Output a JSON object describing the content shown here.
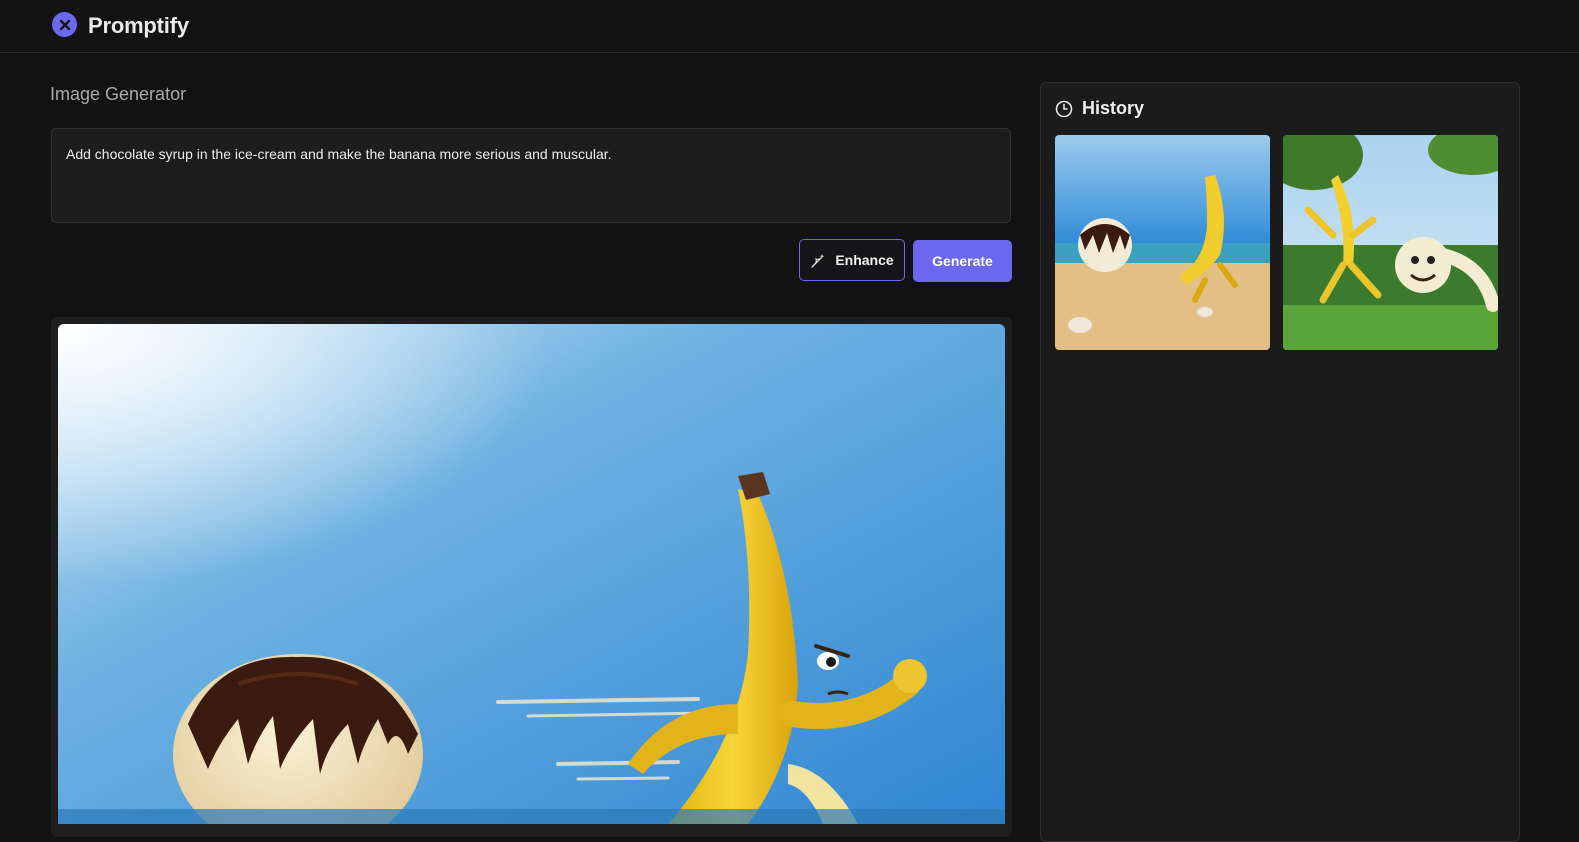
{
  "app": {
    "name": "Promptify",
    "logo_icon": "close-circle-icon",
    "accent_color": "#6d67f0"
  },
  "generator": {
    "title": "Image Generator",
    "prompt_value": "Add chocolate syrup in the ice-cream and make the banana more serious and muscular.",
    "enhance_label": "Enhance",
    "enhance_icon": "magic-wand-icon",
    "generate_label": "Generate"
  },
  "history": {
    "title": "History",
    "icon": "clock-icon",
    "items": [
      {
        "scene": "banana chasing ice cream on beach"
      },
      {
        "scene": "banana and ice cream running on grass"
      }
    ]
  }
}
